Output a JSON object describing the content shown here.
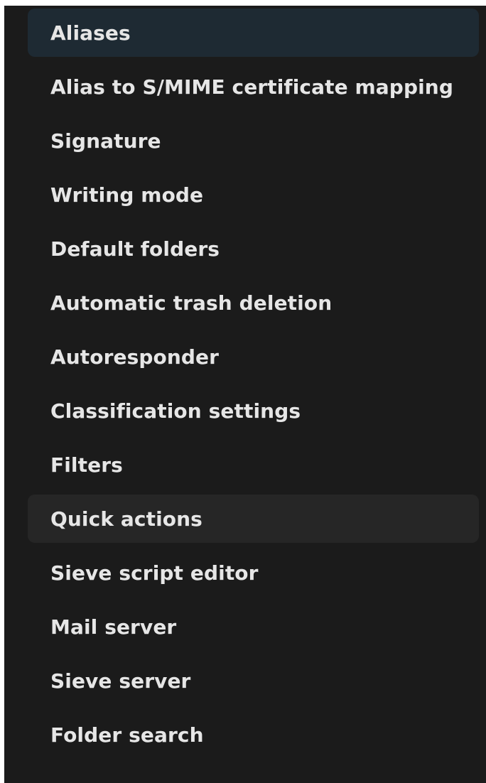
{
  "colors": {
    "panel_background": "#1b1b1b",
    "active_item_background": "#1e2a33",
    "hover_item_background": "#262626",
    "text": "#e6e6e6"
  },
  "settings_menu": {
    "items": [
      {
        "label": "Aliases",
        "state": "selected"
      },
      {
        "label": "Alias to S/MIME certificate mapping",
        "state": "default"
      },
      {
        "label": "Signature",
        "state": "default"
      },
      {
        "label": "Writing mode",
        "state": "default"
      },
      {
        "label": "Default folders",
        "state": "default"
      },
      {
        "label": "Automatic trash deletion",
        "state": "default"
      },
      {
        "label": "Autoresponder",
        "state": "default"
      },
      {
        "label": "Classification settings",
        "state": "default"
      },
      {
        "label": "Filters",
        "state": "default"
      },
      {
        "label": "Quick actions",
        "state": "hovered"
      },
      {
        "label": "Sieve script editor",
        "state": "default"
      },
      {
        "label": "Mail server",
        "state": "default"
      },
      {
        "label": "Sieve server",
        "state": "default"
      },
      {
        "label": "Folder search",
        "state": "default"
      }
    ]
  }
}
